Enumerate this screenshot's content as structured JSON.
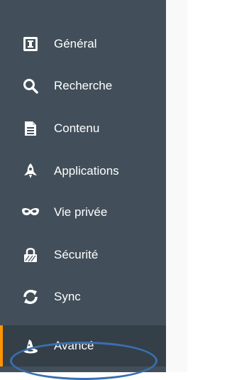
{
  "sidebar": {
    "accent_color": "#ff9400",
    "background_color": "#424f5a",
    "selected_background_color": "#343f48",
    "items": [
      {
        "label": "Général",
        "icon": "general-icon",
        "selected": false
      },
      {
        "label": "Recherche",
        "icon": "search-icon",
        "selected": false
      },
      {
        "label": "Contenu",
        "icon": "document-icon",
        "selected": false
      },
      {
        "label": "Applications",
        "icon": "rocket-icon",
        "selected": false
      },
      {
        "label": "Vie privée",
        "icon": "mask-icon",
        "selected": false
      },
      {
        "label": "Sécurité",
        "icon": "lock-icon",
        "selected": false
      },
      {
        "label": "Sync",
        "icon": "sync-icon",
        "selected": false
      },
      {
        "label": "Avancé",
        "icon": "wizard-hat-icon",
        "selected": true
      }
    ]
  },
  "annotation": {
    "color": "#3b6faf"
  }
}
